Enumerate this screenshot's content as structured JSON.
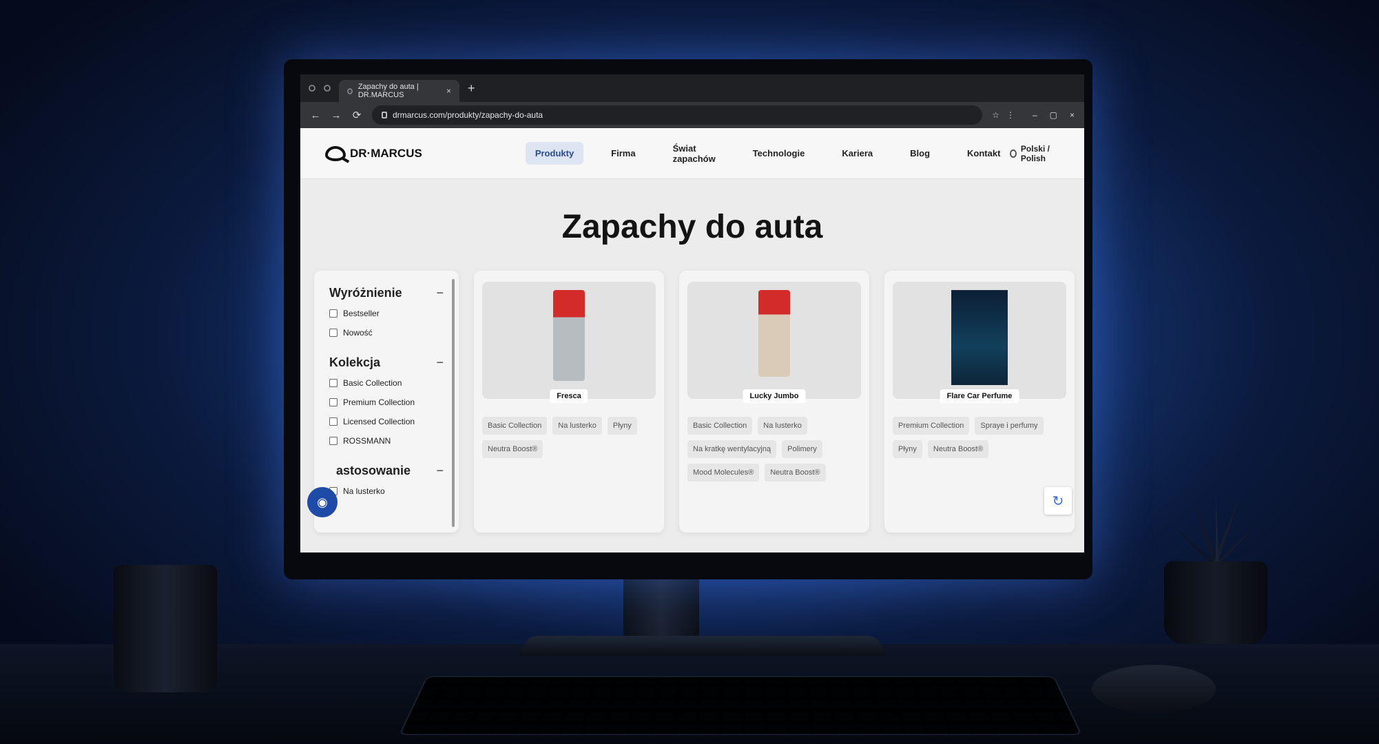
{
  "browser": {
    "tab_title": "Zapachy do auta | DR.MARCUS",
    "url": "drmarcus.com/produkty/zapachy-do-auta",
    "new_tab": "+",
    "tab_close": "×"
  },
  "site": {
    "logo_text": "DR·MARCUS",
    "nav": [
      {
        "label": "Produkty",
        "active": true
      },
      {
        "label": "Firma"
      },
      {
        "label": "Świat zapachów"
      },
      {
        "label": "Technologie"
      },
      {
        "label": "Kariera"
      },
      {
        "label": "Blog"
      },
      {
        "label": "Kontakt"
      }
    ],
    "language": "Polski / Polish"
  },
  "page": {
    "title": "Zapachy do auta"
  },
  "filters": [
    {
      "title": "Wyróżnienie",
      "toggle": "−",
      "options": [
        "Bestseller",
        "Nowość"
      ]
    },
    {
      "title": "Kolekcja",
      "toggle": "−",
      "options": [
        "Basic Collection",
        "Premium Collection",
        "Licensed Collection",
        "ROSSMANN"
      ]
    },
    {
      "title": "astosowanie",
      "toggle": "−",
      "options": [
        "Na lusterko"
      ]
    }
  ],
  "products": [
    {
      "name": "Fresca",
      "tags": [
        "Basic Collection",
        "Na lusterko",
        "Płyny",
        "Neutra Boost®"
      ]
    },
    {
      "name": "Lucky Jumbo",
      "tags": [
        "Basic Collection",
        "Na lusterko",
        "Na kratkę wentylacyjną",
        "Polimery",
        "Mood Molecules®",
        "Neutra Boost®"
      ]
    },
    {
      "name": "Flare Car Perfume",
      "tags": [
        "Premium Collection",
        "Spraye i perfumy",
        "Płyny",
        "Neutra Boost®"
      ]
    }
  ],
  "icons": {
    "back": "←",
    "forward": "→",
    "reload": "⟳",
    "star": "☆",
    "menu": "⋮",
    "minimize": "–",
    "maximize": "▢",
    "close": "×",
    "fingerprint": "◉",
    "recaptcha": "↻"
  },
  "colors": {
    "accent": "#2a4a8f",
    "fingerprint_btn": "#1e4aa8"
  }
}
